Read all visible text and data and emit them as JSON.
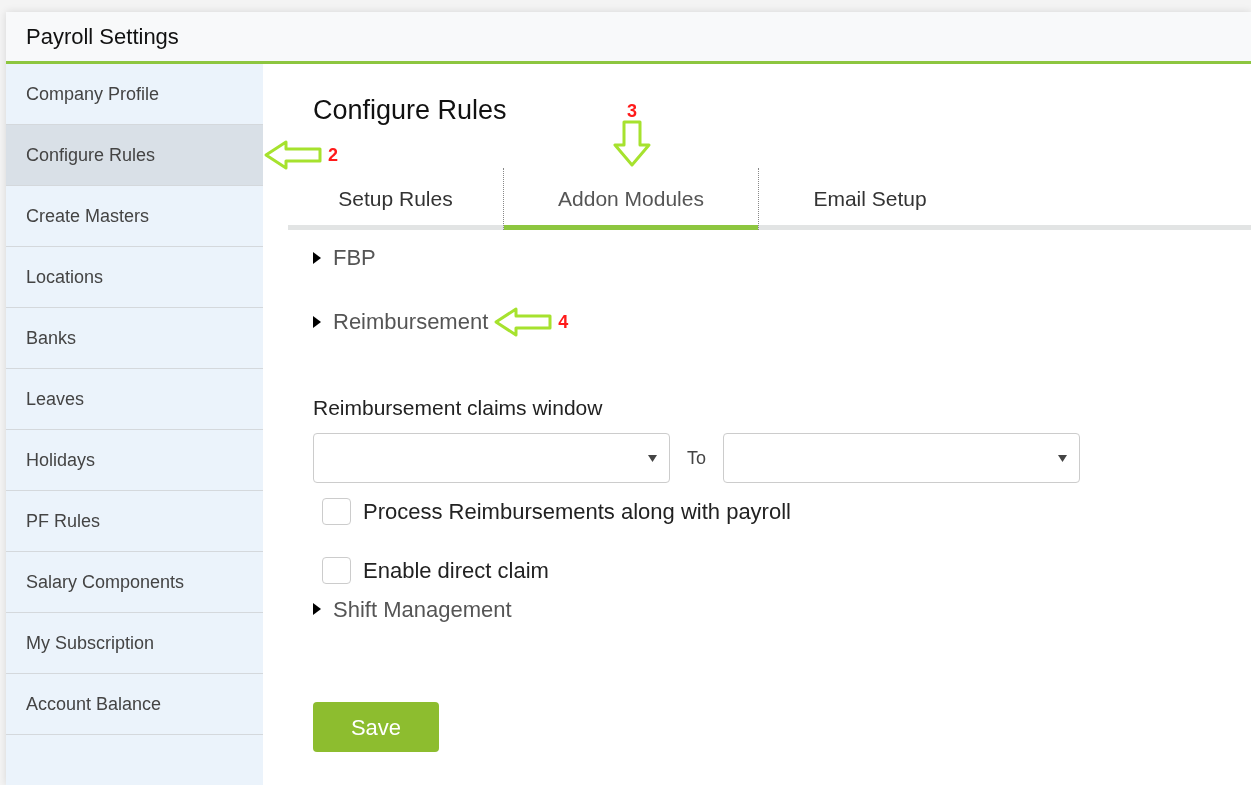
{
  "window": {
    "title": "Payroll Settings"
  },
  "sidebar": {
    "items": [
      {
        "label": "Company Profile",
        "selected": false
      },
      {
        "label": "Configure Rules",
        "selected": true,
        "callout": "2"
      },
      {
        "label": "Create Masters",
        "selected": false
      },
      {
        "label": "Locations",
        "selected": false
      },
      {
        "label": "Banks",
        "selected": false
      },
      {
        "label": "Leaves",
        "selected": false
      },
      {
        "label": "Holidays",
        "selected": false
      },
      {
        "label": "PF Rules",
        "selected": false
      },
      {
        "label": "Salary Components",
        "selected": false
      },
      {
        "label": "My Subscription",
        "selected": false
      },
      {
        "label": "Account Balance",
        "selected": false
      }
    ]
  },
  "page": {
    "title": "Configure Rules"
  },
  "tabs": [
    {
      "label": "Setup Rules",
      "selected": false
    },
    {
      "label": "Addon Modules",
      "selected": true,
      "callout": "3"
    },
    {
      "label": "Email Setup",
      "selected": false
    }
  ],
  "modules": [
    {
      "kind": "collapsible",
      "label": "FBP",
      "expanded": false
    },
    {
      "kind": "collapsible",
      "label": "Reimbursement",
      "expanded": false,
      "callout": "4"
    },
    {
      "kind": "claims-window",
      "label": "Reimbursement claims window",
      "separator": "To"
    },
    {
      "kind": "checkbox",
      "label": "Process Reimbursements along with payroll",
      "checked": false
    },
    {
      "kind": "checkbox",
      "label": "Enable direct claim",
      "checked": false
    },
    {
      "kind": "collapsible",
      "label": "Shift Management",
      "expanded": false
    }
  ],
  "save_button": "Save"
}
